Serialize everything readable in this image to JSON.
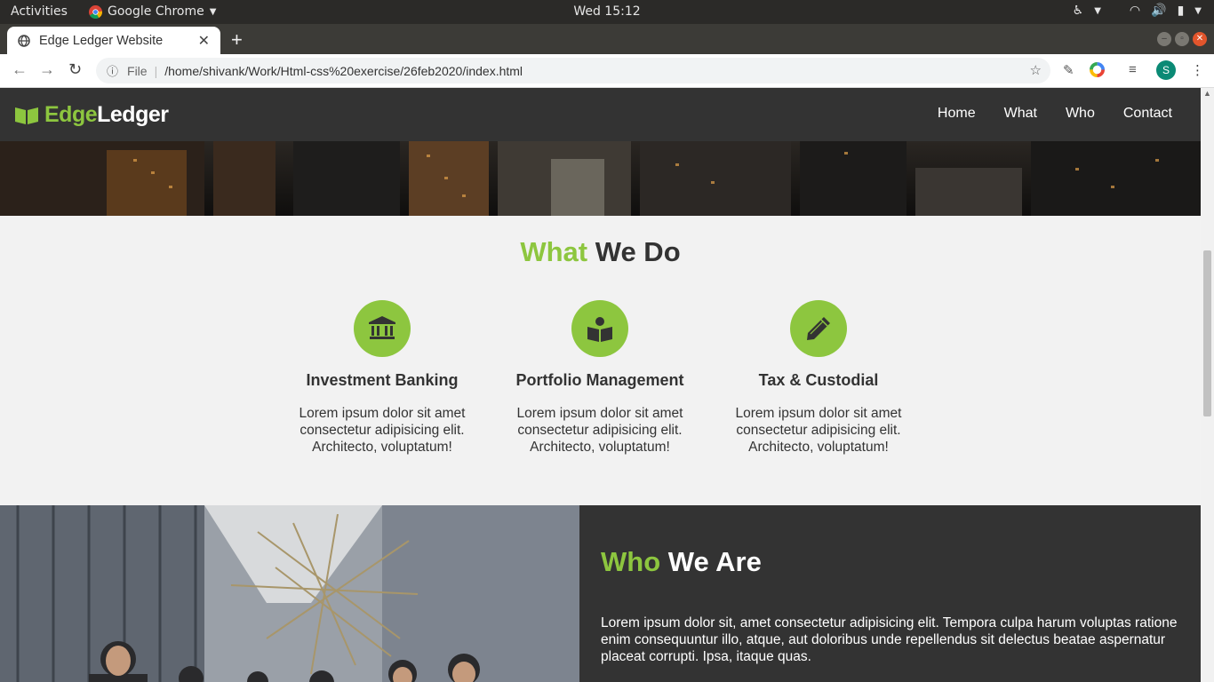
{
  "os": {
    "activities": "Activities",
    "app_name": "Google Chrome",
    "clock": "Wed 15:12"
  },
  "browser": {
    "tab_title": "Edge Ledger Website",
    "file_label": "File",
    "url": "/home/shivank/Work/Html-css%20exercise/26feb2020/index.html",
    "profile_initial": "S"
  },
  "site": {
    "logo_green": "Edge",
    "logo_white": "Ledger",
    "nav": [
      "Home",
      "What",
      "Who",
      "Contact"
    ]
  },
  "what": {
    "title_green": "What",
    "title_rest": "We Do",
    "cards": [
      {
        "icon": "bank-icon",
        "title": "Investment Banking",
        "text": "Lorem ipsum dolor sit amet consectetur adipisicing elit. Architecto, voluptatum!"
      },
      {
        "icon": "reader-book-icon",
        "title": "Portfolio Management",
        "text": "Lorem ipsum dolor sit amet consectetur adipisicing elit. Architecto, voluptatum!"
      },
      {
        "icon": "pencil-icon",
        "title": "Tax & Custodial",
        "text": "Lorem ipsum dolor sit amet consectetur adipisicing elit. Architecto, voluptatum!"
      }
    ]
  },
  "who": {
    "title_green": "Who",
    "title_rest": "We Are",
    "text": "Lorem ipsum dolor sit, amet consectetur adipisicing elit. Tempora culpa harum voluptas ratione enim consequuntur illo, atque, aut doloribus unde repellendus sit delectus beatae aspernatur placeat corrupti. Ipsa, itaque quas."
  },
  "colors": {
    "accent": "#8dc63f",
    "nav_bg": "#333333",
    "page_bg": "#f2f2f2"
  }
}
